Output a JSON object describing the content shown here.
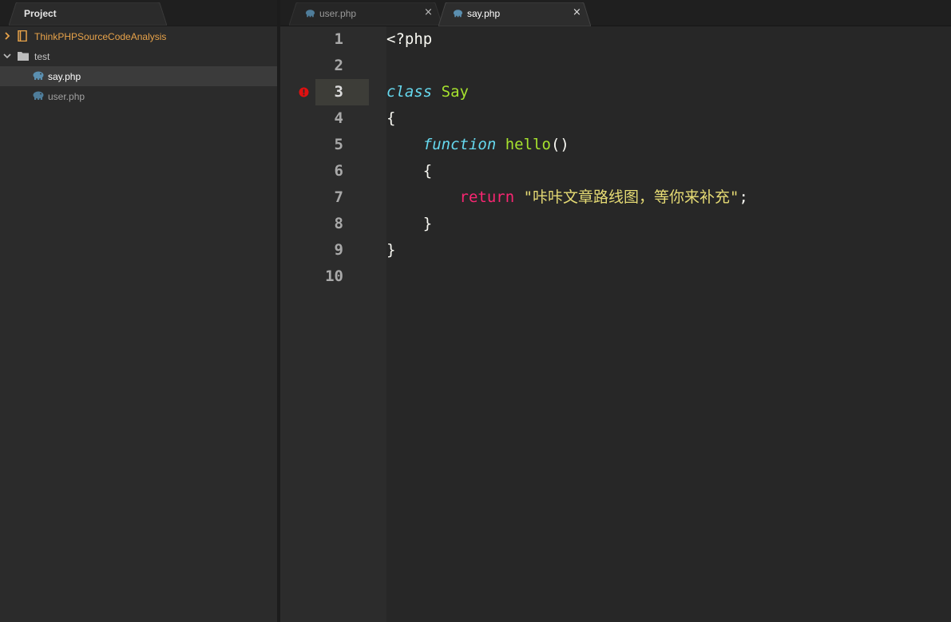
{
  "sidebar": {
    "tab_label": "Project",
    "tree": [
      {
        "label": "ThinkPHPSourceCodeAnalysis",
        "type": "project",
        "expanded": false,
        "color": "#e8a34a"
      },
      {
        "label": "test",
        "type": "folder",
        "expanded": true,
        "color": "#c0c0c0"
      },
      {
        "label": "say.php",
        "type": "php-file",
        "selected": true,
        "color": "#ffffff"
      },
      {
        "label": "user.php",
        "type": "php-file",
        "selected": false,
        "color": "#a0a0a0"
      }
    ]
  },
  "editor": {
    "tabs": [
      {
        "label": "user.php",
        "active": false,
        "close": "×"
      },
      {
        "label": "say.php",
        "active": true,
        "close": "×"
      }
    ],
    "line_numbers": [
      "1",
      "2",
      "3",
      "4",
      "5",
      "6",
      "7",
      "8",
      "9",
      "10"
    ],
    "active_line": "3",
    "breakpoint_line": "3",
    "code": {
      "l1": "<?php",
      "l3_kw": "class",
      "l3_name": "Say",
      "l4": "{",
      "l5_indent": "    ",
      "l5_kw": "function",
      "l5_name": "hello",
      "l5_parens": "()",
      "l6": "    {",
      "l7_indent": "        ",
      "l7_kw": "return",
      "l7_str": "\"咔咔文章路线图，等你来补充\"",
      "l7_end": ";",
      "l8": "    }",
      "l9": "}"
    }
  },
  "colors": {
    "keyword": "#66d9ef",
    "class_name": "#a6e22e",
    "return_kw": "#f92672",
    "string": "#e6db74",
    "breakpoint": "#e01010",
    "project_label": "#e8a34a"
  }
}
